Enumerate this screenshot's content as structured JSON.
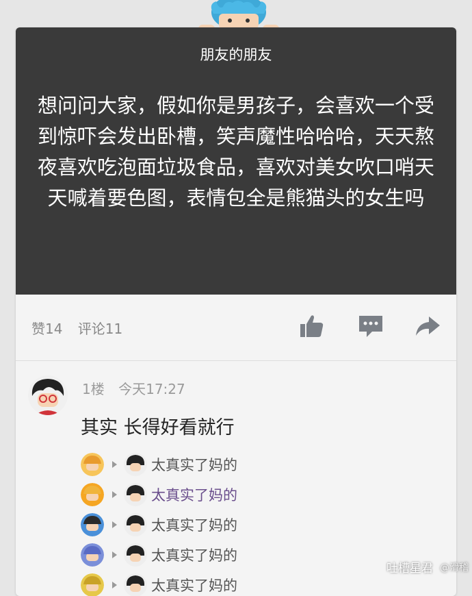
{
  "post": {
    "source": "朋友的朋友",
    "text": "想问问大家，假如你是男孩子，会喜欢一个受到惊吓会发出卧槽，笑声魔性哈哈哈，天天熬夜喜欢吃泡面垃圾食品，喜欢对美女吹口哨天天喊着要色图，表情包全是熊猫头的女生吗"
  },
  "stats": {
    "likes": "赞14",
    "comments": "评论11"
  },
  "icons": {
    "like": "thumbs-up-icon",
    "comment": "comment-icon",
    "share": "share-icon"
  },
  "comment": {
    "floor": "1楼",
    "time": "今天17:27",
    "text": "其实 长得好看就行"
  },
  "replies": [
    {
      "text": "太真实了妈的",
      "color": "#555555"
    },
    {
      "text": "太真实了妈的",
      "color": "#6a4e8c"
    },
    {
      "text": "太真实了妈的",
      "color": "#555555"
    },
    {
      "text": "太真实了妈的",
      "color": "#555555"
    },
    {
      "text": "太真实了妈的",
      "color": "#555555"
    }
  ],
  "watermark": {
    "main": "吐槽星君",
    "sub": "@滑稽"
  },
  "colors": {
    "post_bg": "#3a3a3a",
    "card_bg": "#f4f4f4",
    "page_bg": "#e6e6e6"
  }
}
